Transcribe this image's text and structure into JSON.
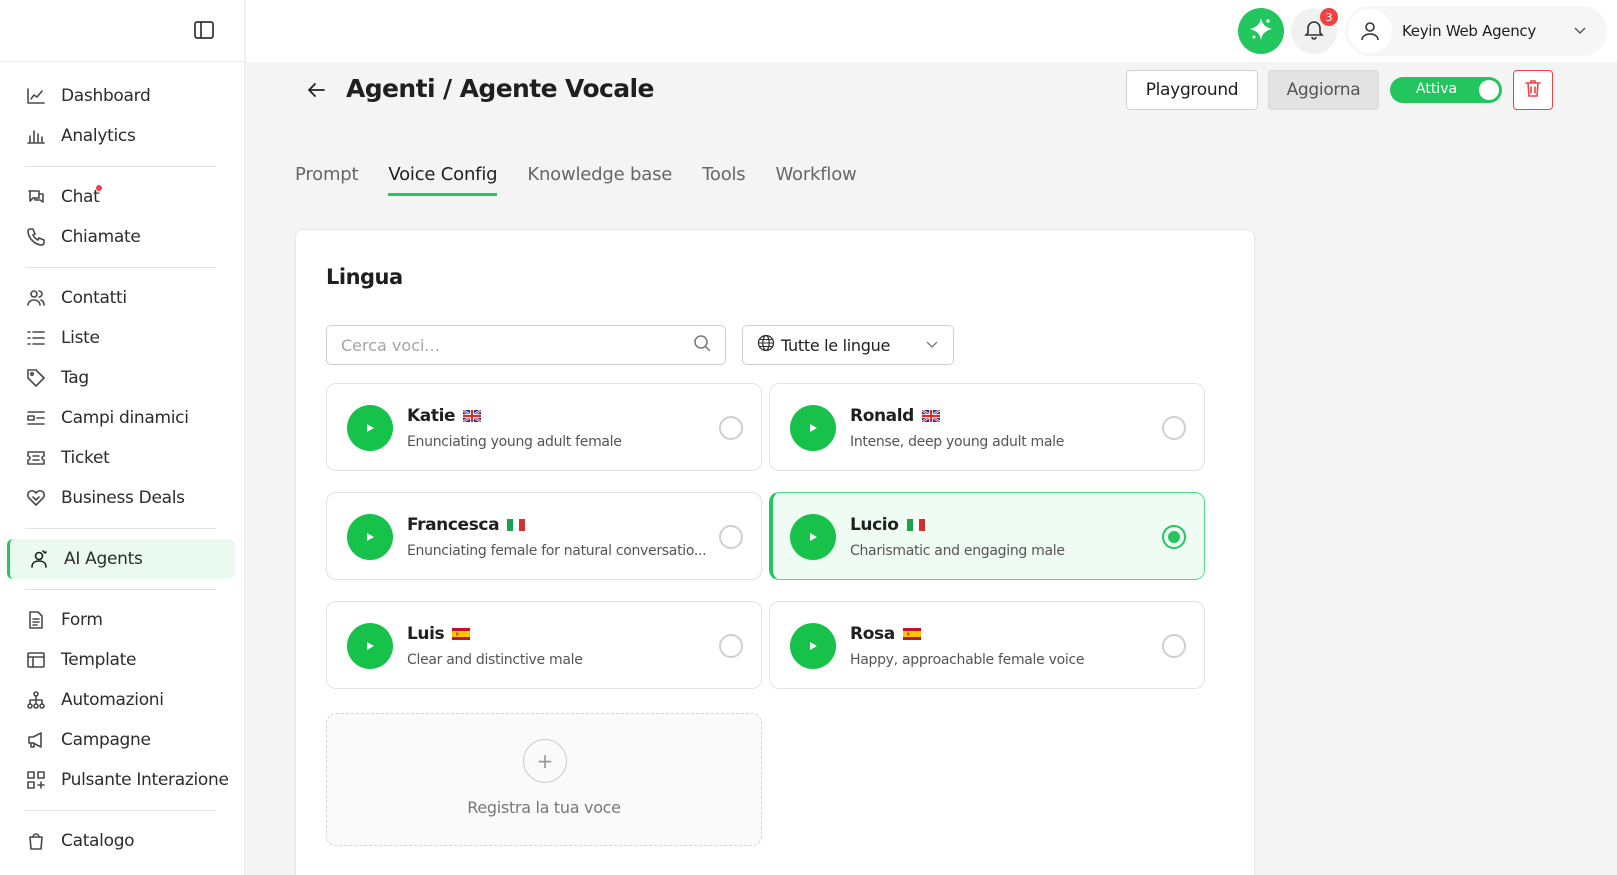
{
  "sidebar": {
    "items": [
      {
        "label": "Dashboard",
        "icon": "chart-line-icon"
      },
      {
        "label": "Analytics",
        "icon": "bar-chart-icon"
      },
      {
        "label": "Chat",
        "icon": "chat-icon"
      },
      {
        "label": "Chiamate",
        "icon": "phone-icon"
      },
      {
        "label": "Contatti",
        "icon": "users-icon"
      },
      {
        "label": "Liste",
        "icon": "list-icon"
      },
      {
        "label": "Tag",
        "icon": "tag-icon"
      },
      {
        "label": "Campi dinamici",
        "icon": "fields-icon"
      },
      {
        "label": "Ticket",
        "icon": "ticket-icon"
      },
      {
        "label": "Business Deals",
        "icon": "handshake-icon"
      },
      {
        "label": "AI Agents",
        "icon": "agent-icon"
      },
      {
        "label": "Form",
        "icon": "form-icon"
      },
      {
        "label": "Template",
        "icon": "template-icon"
      },
      {
        "label": "Automazioni",
        "icon": "automation-icon"
      },
      {
        "label": "Campagne",
        "icon": "megaphone-icon"
      },
      {
        "label": "Pulsante Interazione",
        "icon": "grid-plus-icon"
      },
      {
        "label": "Catalogo",
        "icon": "bag-icon"
      }
    ]
  },
  "topbar": {
    "notification_count": "3",
    "user_name": "Keyin Web Agency"
  },
  "header": {
    "title": "Agenti / Agente Vocale",
    "playground_label": "Playground",
    "update_label": "Aggiorna",
    "toggle_label": "Attiva"
  },
  "tabs": [
    {
      "label": "Prompt"
    },
    {
      "label": "Voice Config"
    },
    {
      "label": "Knowledge base"
    },
    {
      "label": "Tools"
    },
    {
      "label": "Workflow"
    }
  ],
  "voice": {
    "section_title": "Lingua",
    "search_placeholder": "Cerca voci...",
    "language_filter": "Tutte le lingue",
    "voices": [
      {
        "name": "Katie",
        "flag": "uk",
        "description": "Enunciating young adult female"
      },
      {
        "name": "Ronald",
        "flag": "uk",
        "description": "Intense, deep young adult male"
      },
      {
        "name": "Francesca",
        "flag": "it",
        "description": "Enunciating female for natural conversatio..."
      },
      {
        "name": "Lucio",
        "flag": "it",
        "description": "Charismatic and engaging male"
      },
      {
        "name": "Luis",
        "flag": "es",
        "description": "Clear and distinctive male"
      },
      {
        "name": "Rosa",
        "flag": "es",
        "description": "Happy, approachable female voice"
      }
    ],
    "record_label": "Registra la tua voce"
  },
  "colors": {
    "accent": "#22c55e",
    "danger": "#ef4444"
  }
}
